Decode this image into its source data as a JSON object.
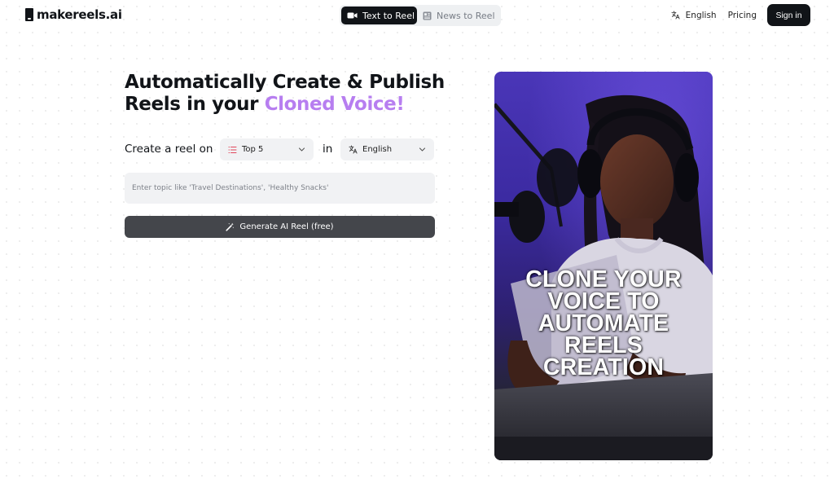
{
  "header": {
    "logo_text": "makereels.ai",
    "mode_tabs": [
      {
        "label": "Text to Reel",
        "icon": "video-camera-icon",
        "active": true
      },
      {
        "label": "News to Reel",
        "icon": "newspaper-icon",
        "active": false
      }
    ],
    "language_label": "English",
    "pricing_label": "Pricing",
    "signin_label": "Sign in"
  },
  "hero": {
    "headline_part1": "Automatically Create & Publish Reels in your ",
    "headline_accent": "Cloned Voice!",
    "create_label": "Create a reel on",
    "format_select": {
      "value": "Top 5",
      "icon": "list-icon"
    },
    "in_label": "in",
    "language_select": {
      "value": "English",
      "icon": "translate-icon"
    },
    "topic_input": {
      "value": "",
      "placeholder": "Enter topic like 'Travel Destinations', 'Healthy Snacks'"
    },
    "generate_label": "Generate AI Reel (free)"
  },
  "preview": {
    "caption_lines": [
      "CLONE YOUR",
      "VOICE TO",
      "AUTOMATE",
      "REELS",
      "CREATION"
    ]
  },
  "colors": {
    "accent": "#b77ef0",
    "dark": "#111418",
    "button": "#44464b",
    "field_bg": "#f1f2f4"
  }
}
